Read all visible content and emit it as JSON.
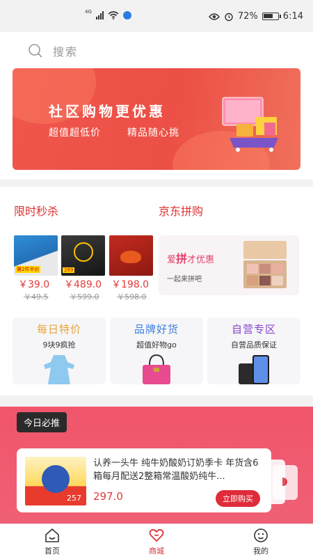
{
  "status_bar": {
    "network_tag": "4G",
    "battery": "72%",
    "battery_level": 0.72,
    "time": "6:14"
  },
  "search": {
    "placeholder": "搜索"
  },
  "banner": {
    "title": "社区购物更优惠",
    "subtitle_left": "超值超低价",
    "subtitle_right": "精品随心挑"
  },
  "flash_sale": {
    "title": "限时秒杀",
    "products": [
      {
        "price": "￥39.0",
        "original_price": "￥49.5",
        "tag": "第2件半价"
      },
      {
        "price": "￥489.0",
        "original_price": "￥599.0",
        "tag": "269"
      },
      {
        "price": "￥198.0",
        "original_price": "￥598.0",
        "tag": ""
      }
    ]
  },
  "group_buy": {
    "title": "京东拼购",
    "headline_pre": "爱",
    "headline_bold": "拼",
    "headline_post": "才优惠",
    "subtitle": "一起来拼吧"
  },
  "categories": [
    {
      "title": "每日特价",
      "subtitle": "9块9疯抢"
    },
    {
      "title": "品牌好货",
      "subtitle": "超值好物go"
    },
    {
      "title": "自营专区",
      "subtitle": "自营品质保证"
    }
  ],
  "recommend": {
    "tag": "今日必推",
    "product_name": "认养一头牛 纯牛奶酸奶订奶季卡 年货含6箱每月配送2整箱常温酸奶纯牛...",
    "price": "297.0",
    "thumb_price": "257",
    "buy_label": "立即购买"
  },
  "tabs": [
    {
      "label": "首页",
      "icon": "home-icon"
    },
    {
      "label": "商城",
      "icon": "heart-icon"
    },
    {
      "label": "我的",
      "icon": "profile-icon"
    }
  ],
  "colors": {
    "accent": "#d8323a",
    "banner_red": "#ec4f45",
    "recommend_bg": "#f0556b"
  }
}
